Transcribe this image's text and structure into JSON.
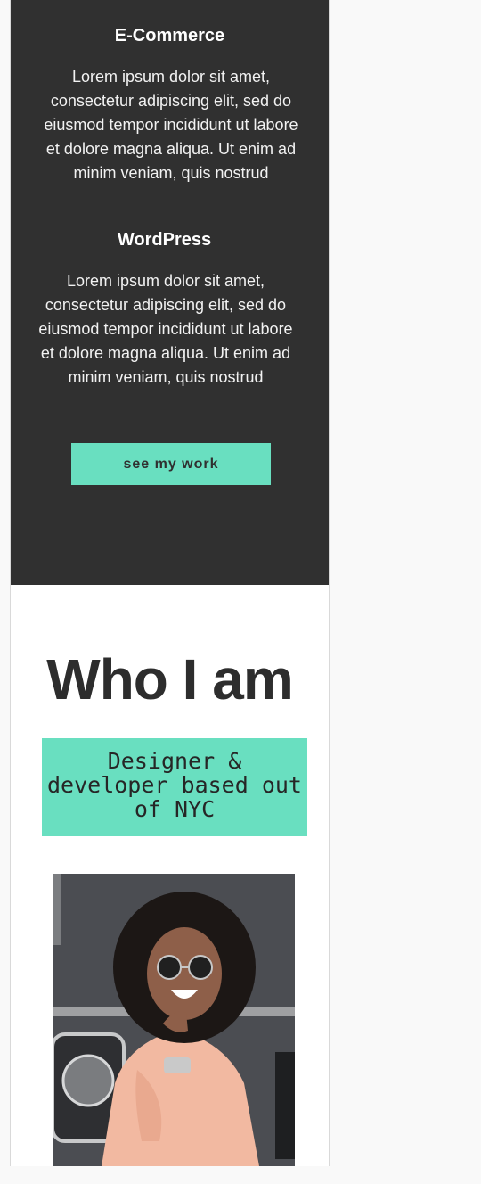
{
  "services": [
    {
      "title": "E-Commerce",
      "description": "Lorem ipsum dolor sit amet, consectetur adipiscing elit, sed do eiusmod tempor incididunt ut labore et dolore magna aliqua. Ut enim ad minim veniam, quis nostrud"
    },
    {
      "title": "WordPress",
      "description": "Lorem ipsum dolor sit amet, consectetur adipiscing elit, sed do eiusmod tempor incididunt ut labore et dolore magna aliqua. Ut enim ad minim veniam, quis nostrud"
    }
  ],
  "cta": {
    "label": "see my work"
  },
  "about": {
    "title": "Who I am",
    "tagline": "Designer & developer based out of NYC"
  },
  "colors": {
    "dark_bg": "#303030",
    "accent": "#69dfc0",
    "text_dark": "#2d2d2d",
    "page_bg": "#f9f9f9"
  }
}
